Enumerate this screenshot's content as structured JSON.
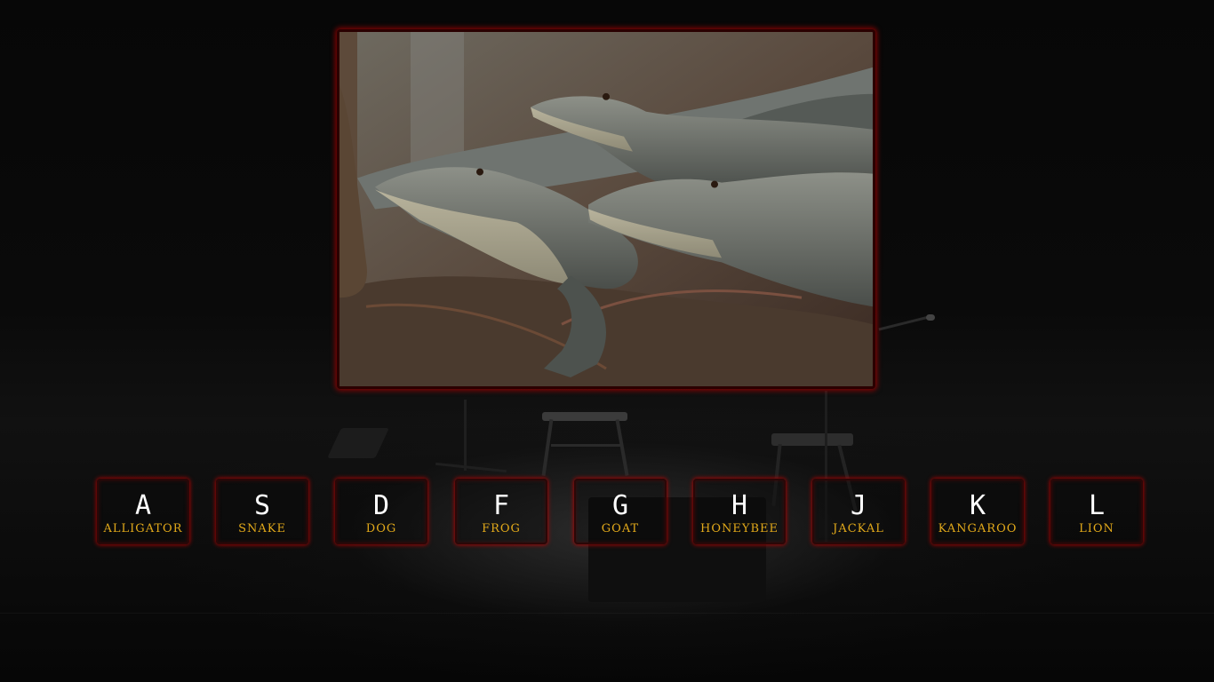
{
  "photo": {
    "subject": "alligators"
  },
  "colors": {
    "background": "#050505",
    "key_border_glow": "#be0000",
    "key_letter": "#ffffff",
    "key_word": "#e2a91a",
    "frame_glow": "#aa0000"
  },
  "keys": [
    {
      "letter": "A",
      "word": "ALLIGATOR"
    },
    {
      "letter": "S",
      "word": "SNAKE"
    },
    {
      "letter": "D",
      "word": "DOG"
    },
    {
      "letter": "F",
      "word": "FROG"
    },
    {
      "letter": "G",
      "word": "GOAT"
    },
    {
      "letter": "H",
      "word": "HONEYBEE"
    },
    {
      "letter": "J",
      "word": "JACKAL"
    },
    {
      "letter": "K",
      "word": "KANGAROO"
    },
    {
      "letter": "L",
      "word": "LION"
    }
  ]
}
